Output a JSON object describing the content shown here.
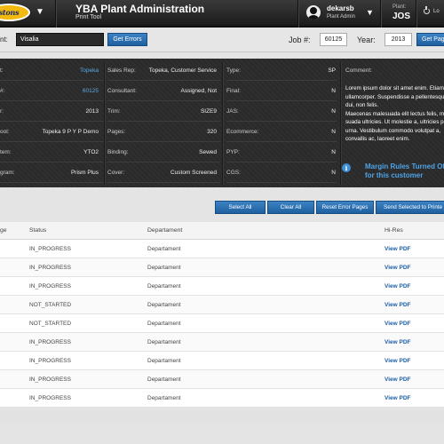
{
  "header": {
    "logo_text": "stons",
    "app_title": "YBA Plant Administration",
    "app_subtitle": "Print Tool",
    "user_name": "dekarsb",
    "user_role": "Plant Admin",
    "plant_label": "Plant:",
    "plant_code": "JOS",
    "logout_label": "Lo"
  },
  "filters": {
    "account_label": "nt:",
    "account_value": "Visalia",
    "get_errors_label": "Get Errors",
    "job_label": "Job #:",
    "job_value": "60125",
    "year_label": "Year:",
    "year_value": "2013",
    "get_pages_label": "Get Page"
  },
  "details": {
    "col1": [
      {
        "key": "t:",
        "value": "Topeka",
        "link": true
      },
      {
        "key": "#:",
        "value": "60125",
        "link": true
      },
      {
        "key": "r:",
        "value": "2013"
      },
      {
        "key": "ool:",
        "value": "Topeka 9 P Y P Demo"
      },
      {
        "key": "tem:",
        "value": "YTO2"
      },
      {
        "key": "gram:",
        "value": "Prism Plus"
      }
    ],
    "col2": [
      {
        "key": "Sales Rep:",
        "value": "Topeka, Customer Service"
      },
      {
        "key": "Consultant:",
        "value": "Assigned, Not"
      },
      {
        "key": "Trim:",
        "value": "SIZE9"
      },
      {
        "key": "Pages:",
        "value": "320"
      },
      {
        "key": "Binding:",
        "value": "Sewed"
      },
      {
        "key": "Cover:",
        "value": "Custom Screened"
      }
    ],
    "col3": [
      {
        "key": "Type:",
        "value": "SP"
      },
      {
        "key": "Final:",
        "value": "N"
      },
      {
        "key": "JAS:",
        "value": "N"
      },
      {
        "key": "Ecommerce:",
        "value": "N"
      },
      {
        "key": "PYP:",
        "value": "N"
      },
      {
        "key": "CGS:",
        "value": "N"
      }
    ],
    "comment_label": "Comment:",
    "comment_lines": [
      "Lorem ipsum dolor sit amet enim. Etiam",
      "ullamcorper. Suspendisse a pellentesque",
      "dui, non felis.",
      "Maecenas malesuada elit lectus felis, ma",
      "suada ultricies. Ut molestie a, ultricies po",
      "urna. Vestibulum commodo volutpat a,",
      "convallis ac, laoreet enim."
    ],
    "margin_rules_line1": "Margin Rules Turned Of",
    "margin_rules_line2": "for this customer"
  },
  "actions": {
    "select_all": "Select All",
    "clear_all": "Clear All",
    "reset_error_pages": "Reset Error Pages",
    "send_selected": "Send Selected to Printe"
  },
  "table": {
    "headers": {
      "page": "ge",
      "status": "Status",
      "department": "Departament",
      "hires": "Hi-Res"
    },
    "rows": [
      {
        "status": "IN_PROGRESS",
        "department": "Departament",
        "hires": "View PDF"
      },
      {
        "status": "IN_PROGRESS",
        "department": "Departament",
        "hires": "View PDF"
      },
      {
        "status": "IN_PROGRESS",
        "department": "Departament",
        "hires": "View PDF"
      },
      {
        "status": "NOT_STARTED",
        "department": "Departament",
        "hires": "View PDF"
      },
      {
        "status": "NOT_STARTED",
        "department": "Departament",
        "hires": "View PDF"
      },
      {
        "status": "IN_PROGRESS",
        "department": "Departament",
        "hires": "View PDF"
      },
      {
        "status": "IN_PROGRESS",
        "department": "Departament",
        "hires": "View PDF"
      },
      {
        "status": "IN_PROGRESS",
        "department": "Departament",
        "hires": "View PDF"
      },
      {
        "status": "IN_PROGRESS",
        "department": "Departament",
        "hires": "View PDF"
      }
    ]
  }
}
